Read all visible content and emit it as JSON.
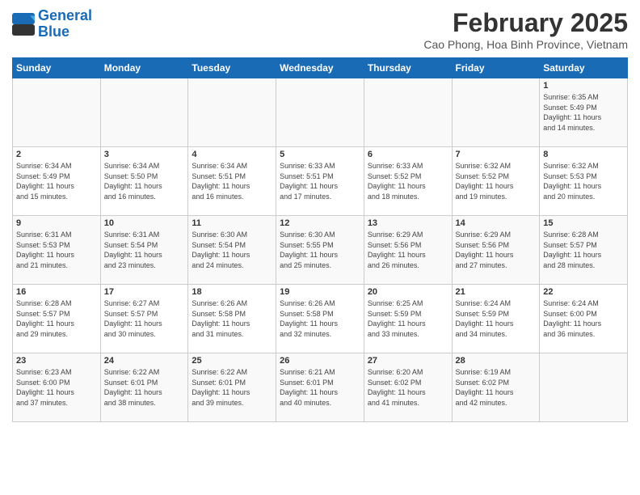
{
  "logo": {
    "line1": "General",
    "line2": "Blue"
  },
  "title": "February 2025",
  "subtitle": "Cao Phong, Hoa Binh Province, Vietnam",
  "weekdays": [
    "Sunday",
    "Monday",
    "Tuesday",
    "Wednesday",
    "Thursday",
    "Friday",
    "Saturday"
  ],
  "weeks": [
    [
      {
        "day": "",
        "info": ""
      },
      {
        "day": "",
        "info": ""
      },
      {
        "day": "",
        "info": ""
      },
      {
        "day": "",
        "info": ""
      },
      {
        "day": "",
        "info": ""
      },
      {
        "day": "",
        "info": ""
      },
      {
        "day": "1",
        "info": "Sunrise: 6:35 AM\nSunset: 5:49 PM\nDaylight: 11 hours\nand 14 minutes."
      }
    ],
    [
      {
        "day": "2",
        "info": "Sunrise: 6:34 AM\nSunset: 5:49 PM\nDaylight: 11 hours\nand 15 minutes."
      },
      {
        "day": "3",
        "info": "Sunrise: 6:34 AM\nSunset: 5:50 PM\nDaylight: 11 hours\nand 16 minutes."
      },
      {
        "day": "4",
        "info": "Sunrise: 6:34 AM\nSunset: 5:51 PM\nDaylight: 11 hours\nand 16 minutes."
      },
      {
        "day": "5",
        "info": "Sunrise: 6:33 AM\nSunset: 5:51 PM\nDaylight: 11 hours\nand 17 minutes."
      },
      {
        "day": "6",
        "info": "Sunrise: 6:33 AM\nSunset: 5:52 PM\nDaylight: 11 hours\nand 18 minutes."
      },
      {
        "day": "7",
        "info": "Sunrise: 6:32 AM\nSunset: 5:52 PM\nDaylight: 11 hours\nand 19 minutes."
      },
      {
        "day": "8",
        "info": "Sunrise: 6:32 AM\nSunset: 5:53 PM\nDaylight: 11 hours\nand 20 minutes."
      }
    ],
    [
      {
        "day": "9",
        "info": "Sunrise: 6:31 AM\nSunset: 5:53 PM\nDaylight: 11 hours\nand 21 minutes."
      },
      {
        "day": "10",
        "info": "Sunrise: 6:31 AM\nSunset: 5:54 PM\nDaylight: 11 hours\nand 23 minutes."
      },
      {
        "day": "11",
        "info": "Sunrise: 6:30 AM\nSunset: 5:54 PM\nDaylight: 11 hours\nand 24 minutes."
      },
      {
        "day": "12",
        "info": "Sunrise: 6:30 AM\nSunset: 5:55 PM\nDaylight: 11 hours\nand 25 minutes."
      },
      {
        "day": "13",
        "info": "Sunrise: 6:29 AM\nSunset: 5:56 PM\nDaylight: 11 hours\nand 26 minutes."
      },
      {
        "day": "14",
        "info": "Sunrise: 6:29 AM\nSunset: 5:56 PM\nDaylight: 11 hours\nand 27 minutes."
      },
      {
        "day": "15",
        "info": "Sunrise: 6:28 AM\nSunset: 5:57 PM\nDaylight: 11 hours\nand 28 minutes."
      }
    ],
    [
      {
        "day": "16",
        "info": "Sunrise: 6:28 AM\nSunset: 5:57 PM\nDaylight: 11 hours\nand 29 minutes."
      },
      {
        "day": "17",
        "info": "Sunrise: 6:27 AM\nSunset: 5:57 PM\nDaylight: 11 hours\nand 30 minutes."
      },
      {
        "day": "18",
        "info": "Sunrise: 6:26 AM\nSunset: 5:58 PM\nDaylight: 11 hours\nand 31 minutes."
      },
      {
        "day": "19",
        "info": "Sunrise: 6:26 AM\nSunset: 5:58 PM\nDaylight: 11 hours\nand 32 minutes."
      },
      {
        "day": "20",
        "info": "Sunrise: 6:25 AM\nSunset: 5:59 PM\nDaylight: 11 hours\nand 33 minutes."
      },
      {
        "day": "21",
        "info": "Sunrise: 6:24 AM\nSunset: 5:59 PM\nDaylight: 11 hours\nand 34 minutes."
      },
      {
        "day": "22",
        "info": "Sunrise: 6:24 AM\nSunset: 6:00 PM\nDaylight: 11 hours\nand 36 minutes."
      }
    ],
    [
      {
        "day": "23",
        "info": "Sunrise: 6:23 AM\nSunset: 6:00 PM\nDaylight: 11 hours\nand 37 minutes."
      },
      {
        "day": "24",
        "info": "Sunrise: 6:22 AM\nSunset: 6:01 PM\nDaylight: 11 hours\nand 38 minutes."
      },
      {
        "day": "25",
        "info": "Sunrise: 6:22 AM\nSunset: 6:01 PM\nDaylight: 11 hours\nand 39 minutes."
      },
      {
        "day": "26",
        "info": "Sunrise: 6:21 AM\nSunset: 6:01 PM\nDaylight: 11 hours\nand 40 minutes."
      },
      {
        "day": "27",
        "info": "Sunrise: 6:20 AM\nSunset: 6:02 PM\nDaylight: 11 hours\nand 41 minutes."
      },
      {
        "day": "28",
        "info": "Sunrise: 6:19 AM\nSunset: 6:02 PM\nDaylight: 11 hours\nand 42 minutes."
      },
      {
        "day": "",
        "info": ""
      }
    ]
  ]
}
